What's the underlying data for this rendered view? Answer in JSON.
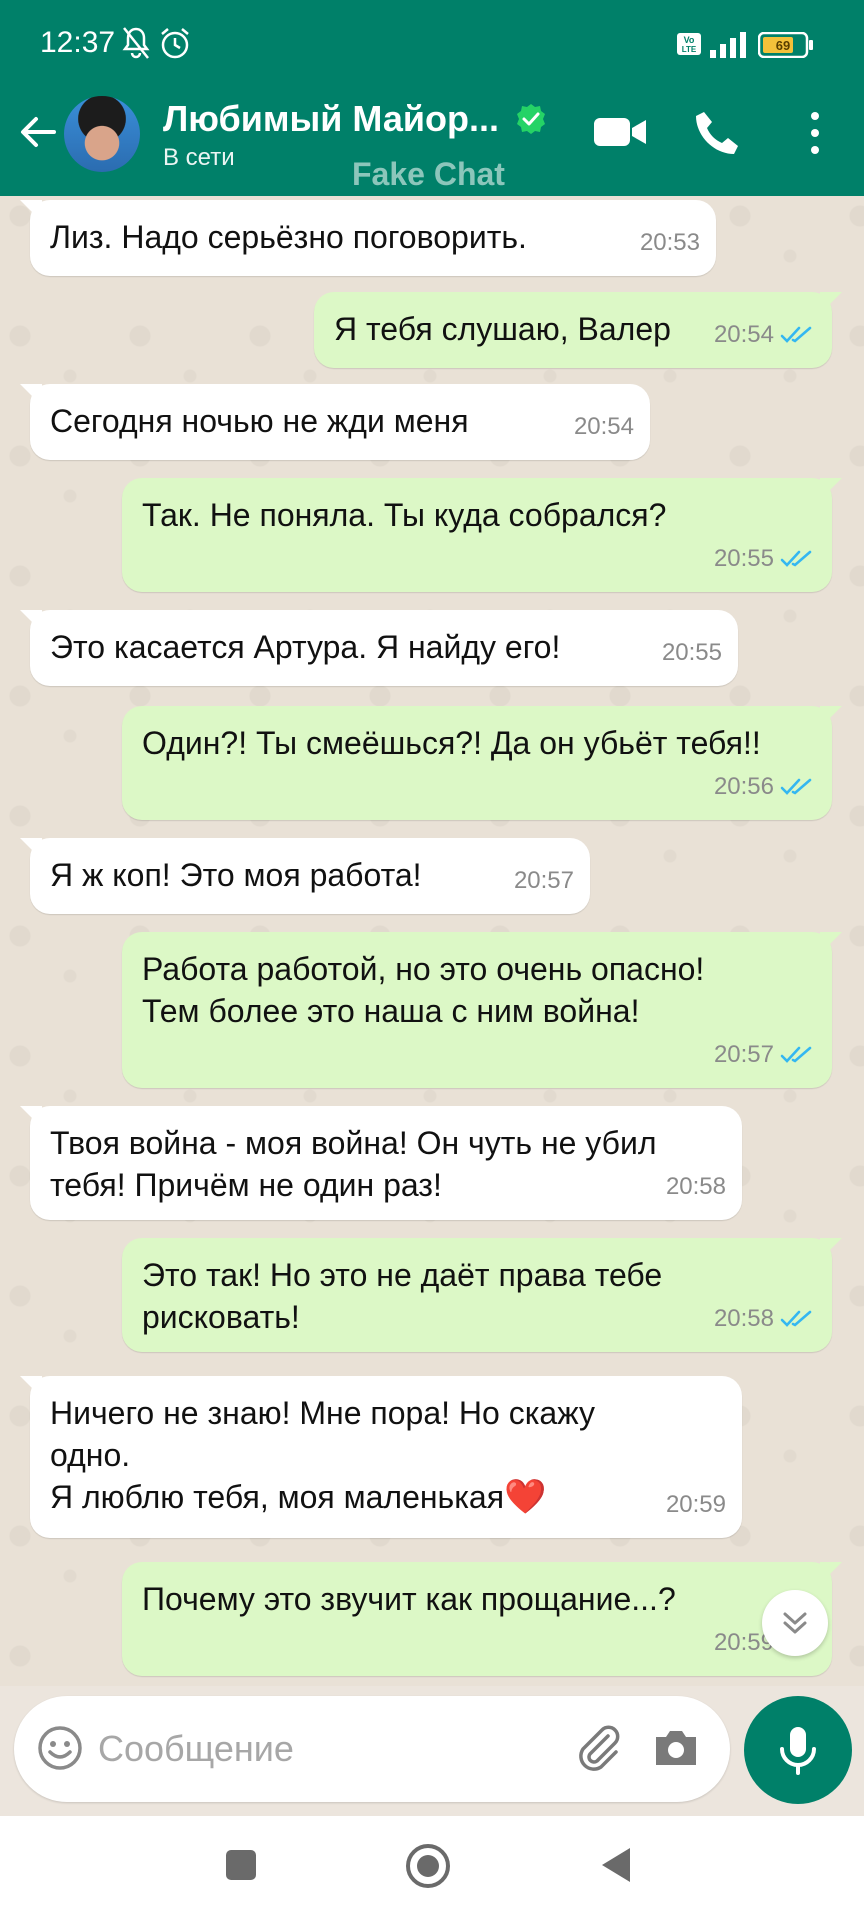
{
  "status_bar": {
    "time": "12:37",
    "battery": "69"
  },
  "header": {
    "contact_name": "Любимый Майор...",
    "presence": "В сети",
    "watermark": "Fake Chat"
  },
  "messages": [
    {
      "dir": "in",
      "text": "Лиз. Надо серьёзно поговорить.",
      "time": "20:53"
    },
    {
      "dir": "out",
      "text": "Я тебя слушаю, Валер",
      "time": "20:54",
      "read": true
    },
    {
      "dir": "in",
      "text": "Сегодня ночью не жди меня",
      "time": "20:54"
    },
    {
      "dir": "out",
      "text": "Так. Не поняла. Ты куда собрался?",
      "time": "20:55",
      "read": true
    },
    {
      "dir": "in",
      "text": "Это касается Артура. Я найду его!",
      "time": "20:55"
    },
    {
      "dir": "out",
      "text": "Один?! Ты смеёшься?! Да он убьёт тебя!!",
      "time": "20:56",
      "read": true
    },
    {
      "dir": "in",
      "text": "Я ж коп! Это моя работа!",
      "time": "20:57"
    },
    {
      "dir": "out",
      "text": "Работа работой, но это очень опасно!\nТем более это наша с ним война!",
      "time": "20:57",
      "read": true
    },
    {
      "dir": "in",
      "text": "Твоя война - моя война! Он чуть не убил\nтебя! Причём не один раз!",
      "time": "20:58"
    },
    {
      "dir": "out",
      "text": "Это так! Но это не даёт права тебе\nрисковать!",
      "time": "20:58",
      "read": true
    },
    {
      "dir": "in",
      "text": "Ничего не знаю! Мне пора! Но скажу\nодно.\nЯ люблю тебя, моя маленькая",
      "emoji": "❤️",
      "time": "20:59"
    },
    {
      "dir": "out",
      "text": "Почему это звучит как прощание...?",
      "time": "20:59",
      "read": true
    }
  ],
  "composer": {
    "placeholder": "Сообщение"
  },
  "colors": {
    "header": "#008069",
    "out_bubble": "#dcf8c6",
    "in_bubble": "#ffffff",
    "tick": "#34b7f1"
  }
}
